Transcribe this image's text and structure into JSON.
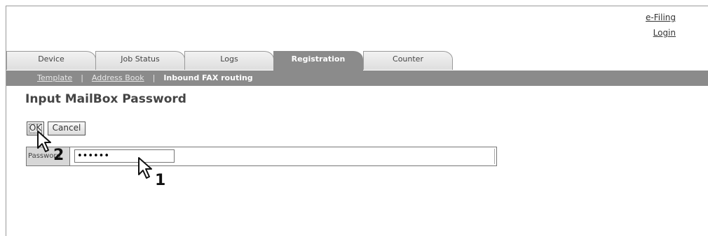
{
  "top_links": {
    "efiling": "e-Filing",
    "login": "Login"
  },
  "tabs": [
    {
      "label": "Device",
      "active": false
    },
    {
      "label": "Job Status",
      "active": false
    },
    {
      "label": "Logs",
      "active": false
    },
    {
      "label": "Registration",
      "active": true
    },
    {
      "label": "Counter",
      "active": false
    }
  ],
  "subnav": {
    "template": "Template",
    "separator": "|",
    "address_book": "Address Book",
    "inbound_fax": "Inbound FAX routing"
  },
  "page_title": "Input MailBox Password",
  "buttons": {
    "ok": "OK",
    "cancel": "Cancel"
  },
  "password_row": {
    "label": "Password",
    "value": "••••••"
  },
  "steps": {
    "one": "1",
    "two": "2"
  }
}
